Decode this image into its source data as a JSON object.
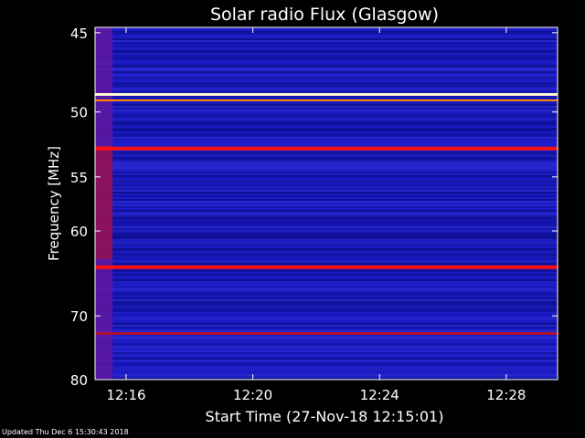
{
  "chart_data": {
    "type": "heatmap",
    "title": "Solar radio Flux (Glasgow)",
    "xlabel": "Start Time (27-Nov-18 12:15:01)",
    "ylabel": "Frequency [MHz]",
    "x_ticks": [
      "12:16",
      "12:20",
      "12:24",
      "12:28"
    ],
    "x_tick_values_min_after_start": [
      0.98,
      4.98,
      8.98,
      12.98
    ],
    "x_range_min_after_start": [
      0,
      14.6
    ],
    "y_ticks": [
      45,
      50,
      55,
      60,
      70,
      80
    ],
    "y_scale": "reciprocal (1/f)",
    "y_range_mhz": [
      44.7,
      80
    ],
    "colormap": "blue-purple-red-orange-white",
    "bright_bands_mhz": [
      {
        "freq": 48.8,
        "intensity": "white"
      },
      {
        "freq": 49.2,
        "intensity": "orange"
      },
      {
        "freq": 52.7,
        "intensity": "red"
      },
      {
        "freq": 63.9,
        "intensity": "red"
      },
      {
        "freq": 72.5,
        "intensity": "dark-red"
      }
    ],
    "early_segment_end_min": 0.55
  },
  "footer": "Updated Thu Dec  6 15:30:43 2018",
  "colors": {
    "background": "#000000",
    "axis": "#ffffff",
    "base": "#1a1ac0"
  }
}
